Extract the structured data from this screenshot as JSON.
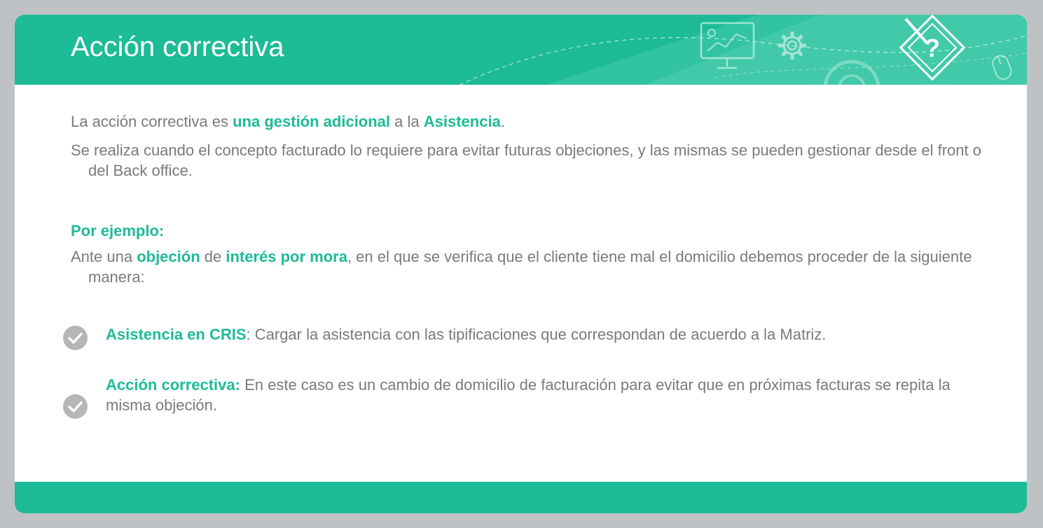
{
  "header": {
    "title": "Acción correctiva",
    "icons": [
      "presentation-board-icon",
      "gear-icon",
      "pencil-question-icon",
      "mouse-icon"
    ]
  },
  "body": {
    "intro": {
      "prefix": "La acción correctiva es ",
      "highlight1": "una gestión adicional",
      "middle": " a la ",
      "highlight2": "Asistencia",
      "suffix": "."
    },
    "detail": "Se realiza cuando el concepto facturado lo requiere para evitar futuras objeciones, y las mismas se pueden gestionar desde el front o del Back office.",
    "example_label": "Por ejemplo:",
    "example": {
      "prefix": "Ante una ",
      "highlight1": "objeción",
      "middle": " de ",
      "highlight2": "interés por mora",
      "suffix": ", en el que se verifica que el cliente tiene mal el domicilio debemos proceder de la siguiente manera:"
    },
    "bullets": [
      {
        "title": "Asistencia en CRIS",
        "text": ": Cargar la asistencia con las tipificaciones que correspondan de acuerdo a la Matriz."
      },
      {
        "title": "Acción correctiva:",
        "text": " En este caso es un cambio de domicilio de facturación para evitar que en próximas facturas se repita la misma objeción."
      }
    ]
  },
  "colors": {
    "accent": "#1dbb98",
    "text": "#7a7a7a",
    "background": "#bfc2c5"
  }
}
